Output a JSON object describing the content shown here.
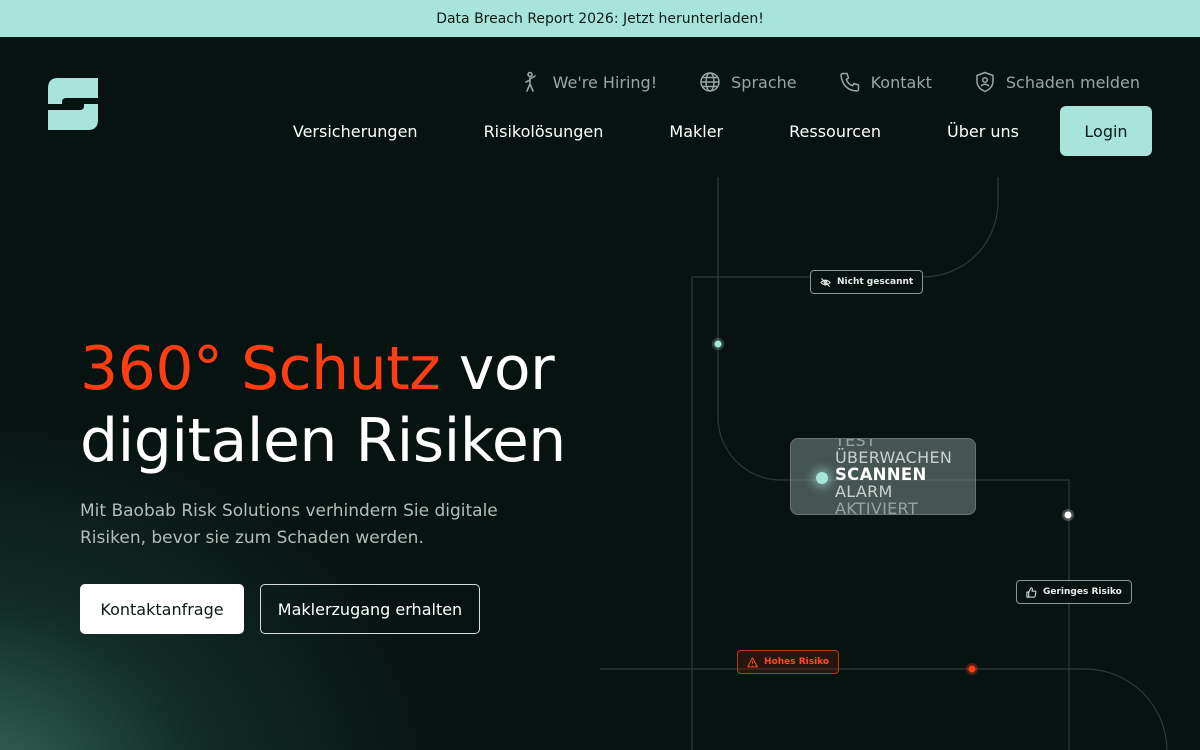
{
  "banner": {
    "text": "Data Breach Report 2026: Jetzt herunterladen!"
  },
  "header": {
    "logo_icon": "baobab-logo-icon",
    "utility_nav": [
      {
        "label": "We're Hiring!",
        "icon": "person-icon"
      },
      {
        "label": "Sprache",
        "icon": "globe-icon"
      },
      {
        "label": "Kontakt",
        "icon": "phone-icon"
      },
      {
        "label": "Schaden melden",
        "icon": "shield-icon"
      }
    ],
    "main_nav": [
      "Versicherungen",
      "Risikolösungen",
      "Makler",
      "Ressourcen",
      "Über uns"
    ],
    "login_label": "Login"
  },
  "hero": {
    "headline_accent": "360° Schutz",
    "headline_rest_1": " vor",
    "headline_line_2": "digitalen Risiken",
    "subtext_line_1": "Mit Baobab Risk Solutions verhindern Sie digitale",
    "subtext_line_2": "Risiken, bevor sie zum Schaden werden.",
    "cta_primary": "Kontaktanfrage",
    "cta_secondary": "Maklerzugang erhalten"
  },
  "graphic": {
    "tag_not_scanned": "Nicht gescannt",
    "tag_low_risk": "Geringes Risiko",
    "tag_high_risk": "Hohes Risiko",
    "scan_words": [
      "TEST",
      "ÜBERWACHEN",
      "SCANNEN",
      "ALARM",
      "AKTIVIERT"
    ]
  },
  "colors": {
    "accent_mint": "#a8e4da",
    "accent_red": "#ff3d13",
    "background": "#061311"
  }
}
